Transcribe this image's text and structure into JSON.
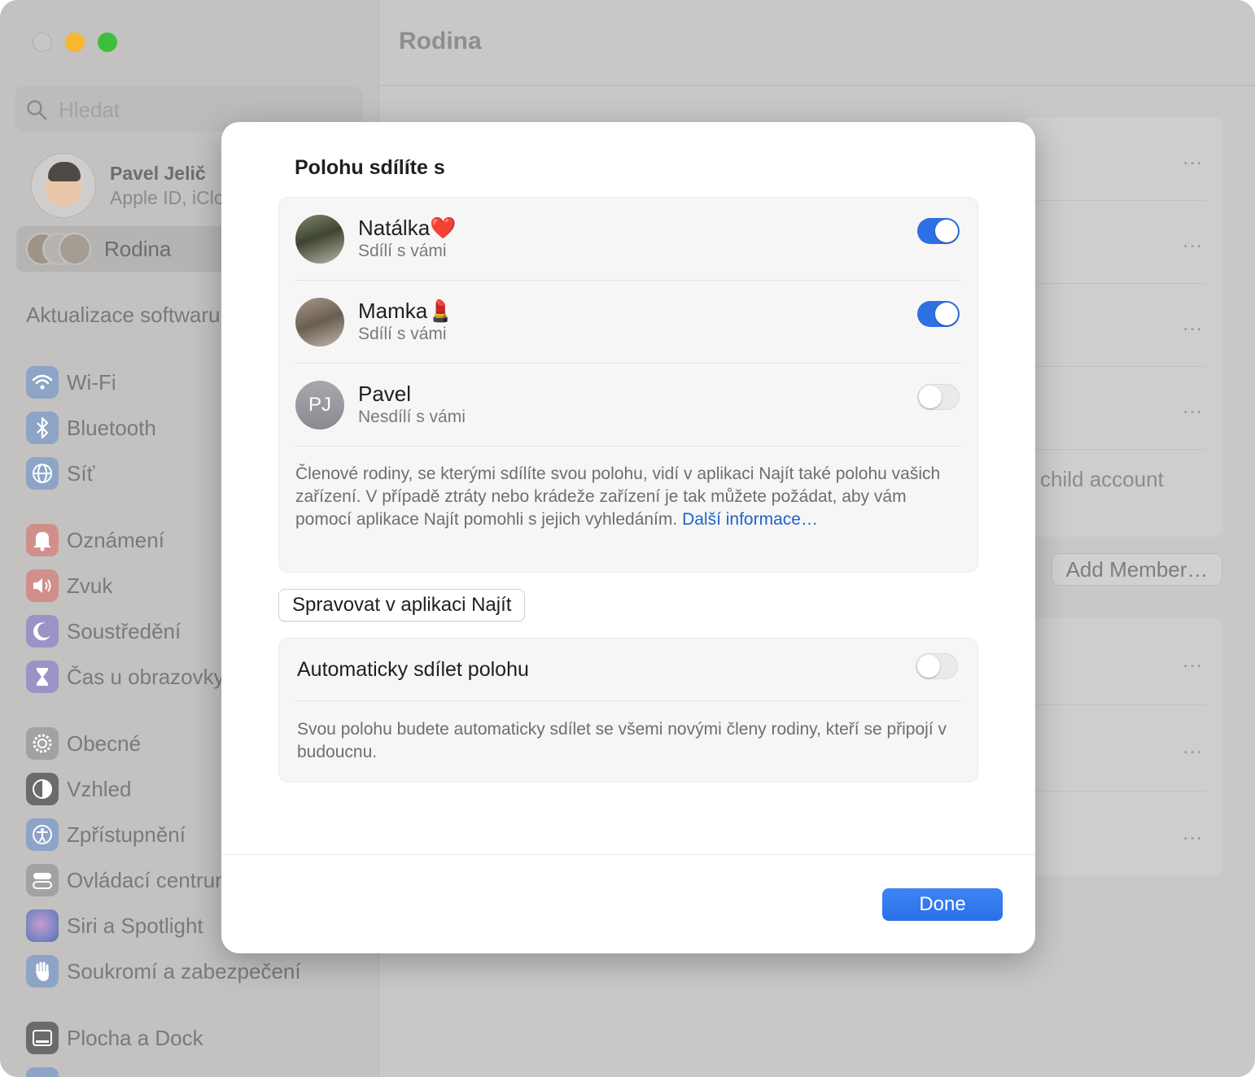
{
  "window": {
    "title": "Rodina"
  },
  "sidebar": {
    "search_placeholder": "Hledat",
    "profile": {
      "name": "Pavel Jelič",
      "subtitle": "Apple ID, iCloud"
    },
    "family_label": "Rodina",
    "software_update": "Aktualizace softwaru",
    "items": [
      {
        "label": "Wi-Fi",
        "icon": "wifi-icon",
        "color": "#8ea4c7"
      },
      {
        "label": "Bluetooth",
        "icon": "bluetooth-icon",
        "color": "#8ea4c7"
      },
      {
        "label": "Síť",
        "icon": "globe-icon",
        "color": "#8ea4c7"
      },
      {
        "label": "Oznámení",
        "icon": "bell-icon",
        "color": "#d18f8c"
      },
      {
        "label": "Zvuk",
        "icon": "speaker-icon",
        "color": "#d18f8c"
      },
      {
        "label": "Soustředění",
        "icon": "moon-icon",
        "color": "#9d92c6"
      },
      {
        "label": "Čas u obrazovky",
        "icon": "hourglass-icon",
        "color": "#9d92c6"
      },
      {
        "label": "Obecné",
        "icon": "gear-icon",
        "color": "#a3a2a0"
      },
      {
        "label": "Vzhled",
        "icon": "appearance-icon",
        "color": "#6c6b69"
      },
      {
        "label": "Zpřístupnění",
        "icon": "accessibility-icon",
        "color": "#8ea4c7"
      },
      {
        "label": "Ovládací centrum",
        "icon": "control-center-icon",
        "color": "#a3a2a0"
      },
      {
        "label": "Siri a Spotlight",
        "icon": "siri-icon",
        "color": "#9a8fbf"
      },
      {
        "label": "Soukromí a zabezpečení",
        "icon": "hand-icon",
        "color": "#8ea4c7"
      },
      {
        "label": "Plocha a Dock",
        "icon": "dock-icon",
        "color": "#6c6b69"
      }
    ]
  },
  "background": {
    "child_account": "child account",
    "add_member": "Add Member…",
    "more": "…"
  },
  "modal": {
    "title": "Polohu sdílíte s",
    "people": [
      {
        "name": "Natálka❤️",
        "status": "Sdílí s vámi",
        "initials": "",
        "sharing": true
      },
      {
        "name": "Mamka💄",
        "status": "Sdílí s vámi",
        "initials": "",
        "sharing": true
      },
      {
        "name": "Pavel",
        "status": "Nesdílí s vámi",
        "initials": "PJ",
        "sharing": false
      }
    ],
    "info_text": "Členové rodiny, se kterými sdílíte svou polohu, vidí v aplikaci Najít také polohu vašich zařízení. V případě ztráty nebo krádeže zařízení je tak můžete požádat, aby vám pomocí aplikace Najít pomohli s jejich vyhledáním. ",
    "info_link": "Další informace…",
    "manage_button": "Spravovat v aplikaci Najít",
    "auto_share_label": "Automaticky sdílet polohu",
    "auto_share_enabled": false,
    "auto_share_info": "Svou polohu budete automaticky sdílet se všemi novými členy rodiny, kteří se připojí v budoucnu.",
    "done_button": "Done",
    "accent_color": "#2f6fe4"
  }
}
